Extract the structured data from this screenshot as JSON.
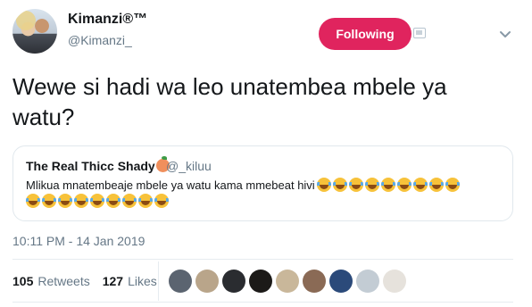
{
  "author": {
    "name": "Kimanzi®™",
    "handle": "@Kimanzi_"
  },
  "follow_button": {
    "label": "Following",
    "color": "#e0245e"
  },
  "tweet": {
    "text": "Wewe si hadi wa leo unatembea mbele ya watu?",
    "timestamp": "10:11 PM - 14 Jan 2019"
  },
  "quoted_tweet": {
    "author_name": "The Real Thicc Shady",
    "author_emoji": "peach-icon",
    "handle": "@_kiluu",
    "text": "Mlikua mnatembeaje mbele ya watu kama mmebeat hivi",
    "emoji_name": "face-with-tears-of-joy-icon",
    "emoji_count_line1": 9,
    "emoji_count_line2": 9
  },
  "stats": {
    "retweets_count": "105",
    "retweets_label": "Retweets",
    "likes_count": "127",
    "likes_label": "Likes"
  },
  "likers": [
    {
      "name": "liker-avatar-1",
      "color": "#5b6470"
    },
    {
      "name": "liker-avatar-2",
      "color": "#b9a58a"
    },
    {
      "name": "liker-avatar-3",
      "color": "#2a2c30"
    },
    {
      "name": "liker-avatar-4",
      "color": "#1c1a18"
    },
    {
      "name": "liker-avatar-5",
      "color": "#c9b79a"
    },
    {
      "name": "liker-avatar-6",
      "color": "#8a6a55"
    },
    {
      "name": "liker-avatar-7",
      "color": "#2b4a7a"
    },
    {
      "name": "liker-avatar-8",
      "color": "#c3ccd4"
    },
    {
      "name": "liker-avatar-9",
      "color": "#e6e2dc"
    }
  ]
}
